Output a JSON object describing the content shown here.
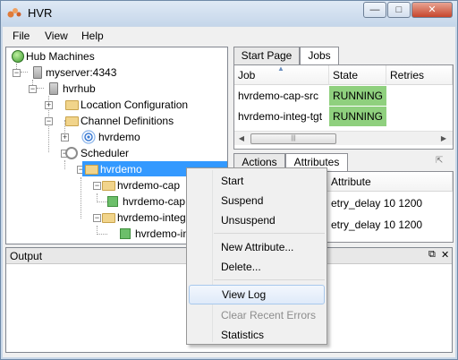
{
  "window": {
    "title": "HVR",
    "minimize_glyph": "—",
    "maximize_glyph": "□",
    "close_glyph": "✕"
  },
  "menubar": {
    "items": [
      "File",
      "View",
      "Help"
    ]
  },
  "tree": {
    "root": "Hub Machines",
    "server": "myserver:4343",
    "hub": "hvrhub",
    "location_config": "Location Configuration",
    "channel_defs": "Channel Definitions",
    "channel_hvrdemo": "hvrdemo",
    "scheduler": "Scheduler",
    "sched_hvrdemo": "hvrdemo",
    "cap_folder": "hvrdemo-cap",
    "cap_job": "hvrdemo-cap",
    "integ_folder": "hvrdemo-integ",
    "integ_job": "hvrdemo-integ"
  },
  "jobs_panel": {
    "tabs": [
      "Start Page",
      "Jobs"
    ],
    "active_tab": "Jobs",
    "columns": [
      "Job",
      "State",
      "Retries"
    ],
    "rows": [
      {
        "job": "hvrdemo-cap-src",
        "state": "RUNNING",
        "retries": ""
      },
      {
        "job": "hvrdemo-integ-tgt",
        "state": "RUNNING",
        "retries": ""
      }
    ],
    "status_color": "#8fd07e"
  },
  "attr_panel": {
    "tabs": [
      "Actions",
      "Attributes"
    ],
    "active_tab": "Attributes",
    "columns": [
      "Attribute"
    ],
    "rows": [
      "etry_delay 10 1200",
      "etry_delay 10 1200"
    ]
  },
  "output": {
    "title": "Output"
  },
  "context_menu": {
    "groups": [
      [
        "Start",
        "Suspend",
        "Unsuspend"
      ],
      [
        "New Attribute...",
        "Delete..."
      ],
      [
        "View Log",
        "Clear Recent Errors",
        "Statistics"
      ]
    ],
    "hovered": "View Log",
    "disabled": [
      "Clear Recent Errors"
    ]
  },
  "colors": {
    "selection": "#3399ff",
    "running": "#8fd07e"
  }
}
